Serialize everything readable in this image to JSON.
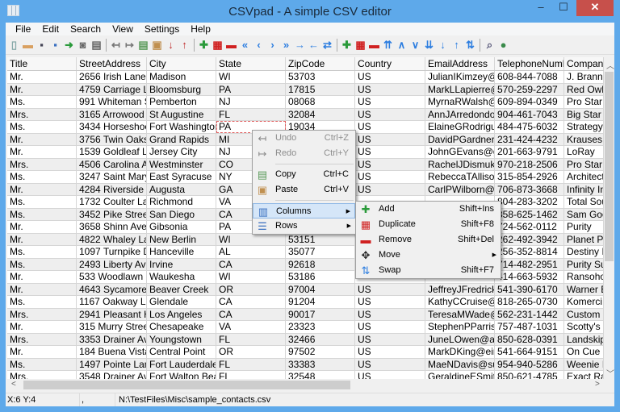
{
  "window": {
    "title": "CSVpad - A simple CSV editor",
    "minimize": "–",
    "maximize": "☐",
    "close": "✕"
  },
  "menubar": [
    "File",
    "Edit",
    "Search",
    "View",
    "Settings",
    "Help"
  ],
  "toolbar": [
    "new-file",
    "open-folder",
    "save",
    "save-as",
    "export",
    "snapshot",
    "print",
    "|",
    "undo",
    "redo",
    "copy",
    "paste",
    "sort-az",
    "sort-za",
    "|",
    "add-column",
    "duplicate-column",
    "remove-column",
    "move-first",
    "move-left",
    "move-right",
    "move-last",
    "move-right-arrow",
    "move-left-arrow",
    "swap-columns",
    "|",
    "add-row",
    "duplicate-row",
    "remove-row",
    "move-top",
    "move-up",
    "move-down",
    "move-bottom",
    "move-down-arrow",
    "move-up-arrow",
    "swap-rows",
    "|",
    "search",
    "web"
  ],
  "grid": {
    "columns": [
      "Title",
      "StreetAddress",
      "City",
      "State",
      "ZipCode",
      "Country",
      "EmailAddress",
      "TelephoneNumb",
      "Company"
    ],
    "selected_cell": {
      "row": 4,
      "col": 3
    },
    "rows": [
      [
        "Mr.",
        "2656 Irish Lane",
        "Madison",
        "WI",
        "53703",
        "US",
        "JulianIKimzey@",
        "608-844-7088",
        "J. Branna"
      ],
      [
        "Mr.",
        "4759 Carriage La",
        "Bloomsburg",
        "PA",
        "17815",
        "US",
        "MarkLLapierre@",
        "570-259-2297",
        "Red Owl"
      ],
      [
        "Ms.",
        "991 Whiteman S",
        "Pemberton",
        "NJ",
        "08068",
        "US",
        "MyrnaRWalsh@",
        "609-894-0349",
        "Pro Star"
      ],
      [
        "Mrs.",
        "3165 Arrowood D",
        "St Augustine",
        "FL",
        "32084",
        "US",
        "AnnJArredondo@",
        "904-461-7043",
        "Big Star"
      ],
      [
        "Ms.",
        "3434 Horseshoe",
        "Fort Washington",
        "PA",
        "19034",
        "US",
        "ElaineGRodrigue",
        "484-475-6032",
        "Strategy"
      ],
      [
        "Mr.",
        "3756 Twin Oaks",
        "Grand Rapids",
        "MI",
        "",
        "US",
        "DavidPGardner@",
        "231-424-4232",
        "Krauses"
      ],
      [
        "Mr.",
        "1539 Goldleaf La",
        "Jersey City",
        "NJ",
        "",
        "US",
        "JohnGEvans@g",
        "201-663-9791",
        "LoRay"
      ],
      [
        "Mrs.",
        "4506 Carolina Av",
        "Westminster",
        "CO",
        "",
        "US",
        "RachelJDismuke",
        "970-218-2506",
        "Pro Star"
      ],
      [
        "Ms.",
        "3247 Saint Mary",
        "East Syracuse",
        "NY",
        "",
        "US",
        "RebeccaTAllison",
        "315-854-2926",
        "Architect"
      ],
      [
        "Mr.",
        "4284 Riverside D",
        "Augusta",
        "GA",
        "",
        "US",
        "CarlPWilborn@",
        "706-873-3668",
        "Infinity In"
      ],
      [
        "Ms.",
        "1732 Coulter Lar",
        "Richmond",
        "VA",
        "",
        "",
        "",
        "804-283-3202",
        "Total Sou"
      ],
      [
        "Ms.",
        "3452 Pike Street",
        "San Diego",
        "CA",
        "",
        "",
        "",
        "858-625-1462",
        "Sam Goo"
      ],
      [
        "Mr.",
        "3658 Shinn Aven",
        "Gibsonia",
        "PA",
        "",
        "",
        "",
        "724-562-0112",
        "Purity"
      ],
      [
        "Mr.",
        "4822 Whaley La",
        "New Berlin",
        "WI",
        "53151",
        "",
        "",
        "262-492-3942",
        "Planet P"
      ],
      [
        "Ms.",
        "1097 Turnpike D",
        "Hanceville",
        "AL",
        "35077",
        "",
        "",
        "256-352-8814",
        "Destiny I"
      ],
      [
        "Ms.",
        "2493 Liberty Ave",
        "Irvine",
        "CA",
        "92618",
        "",
        "",
        "714-482-2951",
        "Purity Su"
      ],
      [
        "Mr.",
        "533 Woodlawn D",
        "Waukesha",
        "WI",
        "53186",
        "",
        "",
        "414-663-5932",
        "Ransoho"
      ],
      [
        "Mr.",
        "4643 Sycamore",
        "Beaver Creek",
        "OR",
        "97004",
        "US",
        "JeffreyJFredricks",
        "541-390-6170",
        "Warner E"
      ],
      [
        "Ms.",
        "1167 Oakway La",
        "Glendale",
        "CA",
        "91204",
        "US",
        "KathyCCruise@",
        "818-265-0730",
        "Komerci"
      ],
      [
        "Mrs.",
        "2941 Pleasant H",
        "Los Angeles",
        "CA",
        "90017",
        "US",
        "TeresaMWade@",
        "562-231-1442",
        "Custom"
      ],
      [
        "Mr.",
        "315 Murry Street",
        "Chesapeake",
        "VA",
        "23323",
        "US",
        "StephenPParrisl",
        "757-487-1031",
        "Scotty's"
      ],
      [
        "Mrs.",
        "3353 Drainer Ave",
        "Youngstown",
        "FL",
        "32466",
        "US",
        "JuneLOwen@ar",
        "850-628-0391",
        "Landskip"
      ],
      [
        "Mr.",
        "184 Buena Vista",
        "Central Point",
        "OR",
        "97502",
        "US",
        "MarkDKing@ein",
        "541-664-9151",
        "On Cue"
      ],
      [
        "Ms.",
        "1497 Pointe Lan",
        "Fort Lauderdale",
        "FL",
        "33383",
        "US",
        "MaeNDavis@su",
        "954-940-5286",
        "Weenie I"
      ],
      [
        "Mrs.",
        "3548 Drainer Ave",
        "Fort Walton Bea",
        "FL",
        "32548",
        "US",
        "GeraldineESmitl",
        "850-621-4785",
        "Exact Ra"
      ]
    ]
  },
  "context_menu": {
    "items": [
      {
        "label": "Undo",
        "shortcut": "Ctrl+Z",
        "icon": "undo-icon",
        "disabled": true
      },
      {
        "label": "Redo",
        "shortcut": "Ctrl+Y",
        "icon": "redo-icon",
        "disabled": true
      },
      {
        "label": "Copy",
        "shortcut": "Ctrl+C",
        "icon": "copy-icon"
      },
      {
        "label": "Paste",
        "shortcut": "Ctrl+V",
        "icon": "paste-icon"
      },
      {
        "label": "Columns",
        "icon": "columns-icon",
        "submenu": true,
        "highlighted": true
      },
      {
        "label": "Rows",
        "icon": "rows-icon",
        "submenu": true
      }
    ]
  },
  "columns_submenu": {
    "items": [
      {
        "label": "Add",
        "shortcut": "Shift+Ins",
        "icon": "add-icon"
      },
      {
        "label": "Duplicate",
        "shortcut": "Shift+F8",
        "icon": "duplicate-icon"
      },
      {
        "label": "Remove",
        "shortcut": "Shift+Del",
        "icon": "remove-icon"
      },
      {
        "label": "Move",
        "icon": "move-icon",
        "submenu": true
      },
      {
        "label": "Swap",
        "shortcut": "Shift+F7",
        "icon": "swap-icon"
      }
    ]
  },
  "statusbar": {
    "position": "X:6  Y:4",
    "delimiter": ",",
    "file": "N:\\TestFiles\\Misc\\sample_contacts.csv"
  },
  "colors": {
    "frame": "#5ea9ea",
    "close": "#c7504b",
    "menu_highlight": "#d5e6f8"
  }
}
